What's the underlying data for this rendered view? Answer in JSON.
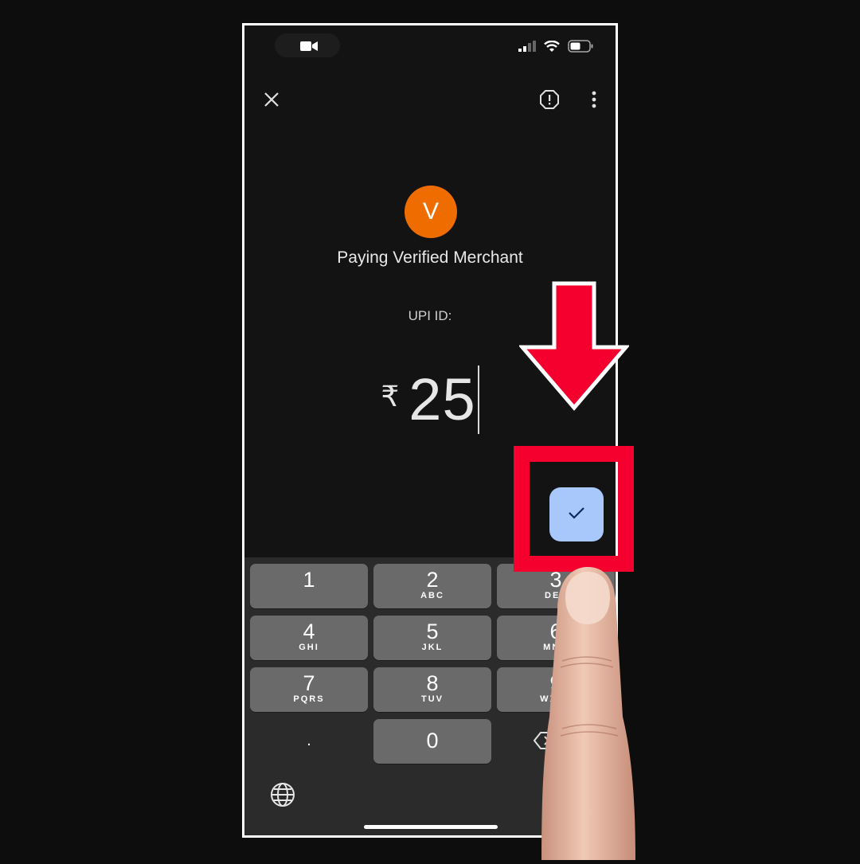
{
  "payment": {
    "avatar_initial": "V",
    "payee_label": "Paying Verified Merchant",
    "upi_label": "UPI ID:",
    "currency_symbol": "₹",
    "amount": "25"
  },
  "header": {
    "close_icon": "close-icon",
    "report_icon": "report-icon",
    "more_icon": "more-vert-icon"
  },
  "keypad": {
    "keys": [
      {
        "digit": "1",
        "letters": ""
      },
      {
        "digit": "2",
        "letters": "ABC"
      },
      {
        "digit": "3",
        "letters": "DEF"
      },
      {
        "digit": "4",
        "letters": "GHI"
      },
      {
        "digit": "5",
        "letters": "JKL"
      },
      {
        "digit": "6",
        "letters": "MNO"
      },
      {
        "digit": "7",
        "letters": "PQRS"
      },
      {
        "digit": "8",
        "letters": "TUV"
      },
      {
        "digit": "9",
        "letters": "WXYZ"
      },
      {
        "digit": ".",
        "letters": ""
      },
      {
        "digit": "0",
        "letters": ""
      }
    ]
  },
  "colors": {
    "avatar": "#ee6c00",
    "confirm_button": "#a8c7fa",
    "highlight": "#f5002e"
  }
}
